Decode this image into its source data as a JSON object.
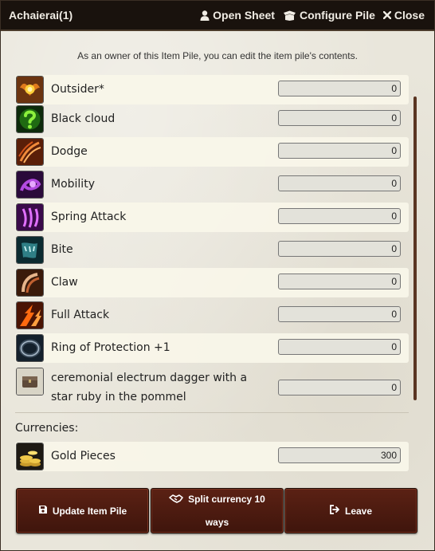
{
  "window": {
    "title": "Achaierai(1)",
    "actions": {
      "open_sheet": "Open Sheet",
      "configure_pile": "Configure Pile",
      "close": "Close"
    }
  },
  "notice": "As an owner of this Item Pile, you can edit the item pile's contents.",
  "items": [
    {
      "name": "Outsider*",
      "quantity": "0",
      "icon": "winged-emblem-icon"
    },
    {
      "name": "Black cloud",
      "quantity": "0",
      "icon": "green-question-icon"
    },
    {
      "name": "Dodge",
      "quantity": "0",
      "icon": "dodge-slash-icon"
    },
    {
      "name": "Mobility",
      "quantity": "0",
      "icon": "purple-swirl-icon"
    },
    {
      "name": "Spring Attack",
      "quantity": "0",
      "icon": "purple-claw-icon"
    },
    {
      "name": "Bite",
      "quantity": "0",
      "icon": "teal-bite-icon"
    },
    {
      "name": "Claw",
      "quantity": "0",
      "icon": "claw-icon"
    },
    {
      "name": "Full Attack",
      "quantity": "0",
      "icon": "fire-strike-icon"
    },
    {
      "name": "Ring of Protection +1",
      "quantity": "0",
      "icon": "ring-icon"
    },
    {
      "name": "ceremonial electrum dagger with a star ruby in the pommel",
      "quantity": "0",
      "icon": "chest-icon"
    }
  ],
  "currencies": {
    "label": "Currencies:",
    "items": [
      {
        "name": "Gold Pieces",
        "quantity": "300",
        "icon": "gold-coins-icon"
      }
    ]
  },
  "buttons": {
    "update": "Update Item Pile",
    "split": "Split currency 10 ways",
    "leave": "Leave"
  },
  "colors": {
    "titlebar": "#19120d",
    "button": "#4a1a0f",
    "scrollbar": "#5a3522",
    "panel": "#e9e6db"
  }
}
